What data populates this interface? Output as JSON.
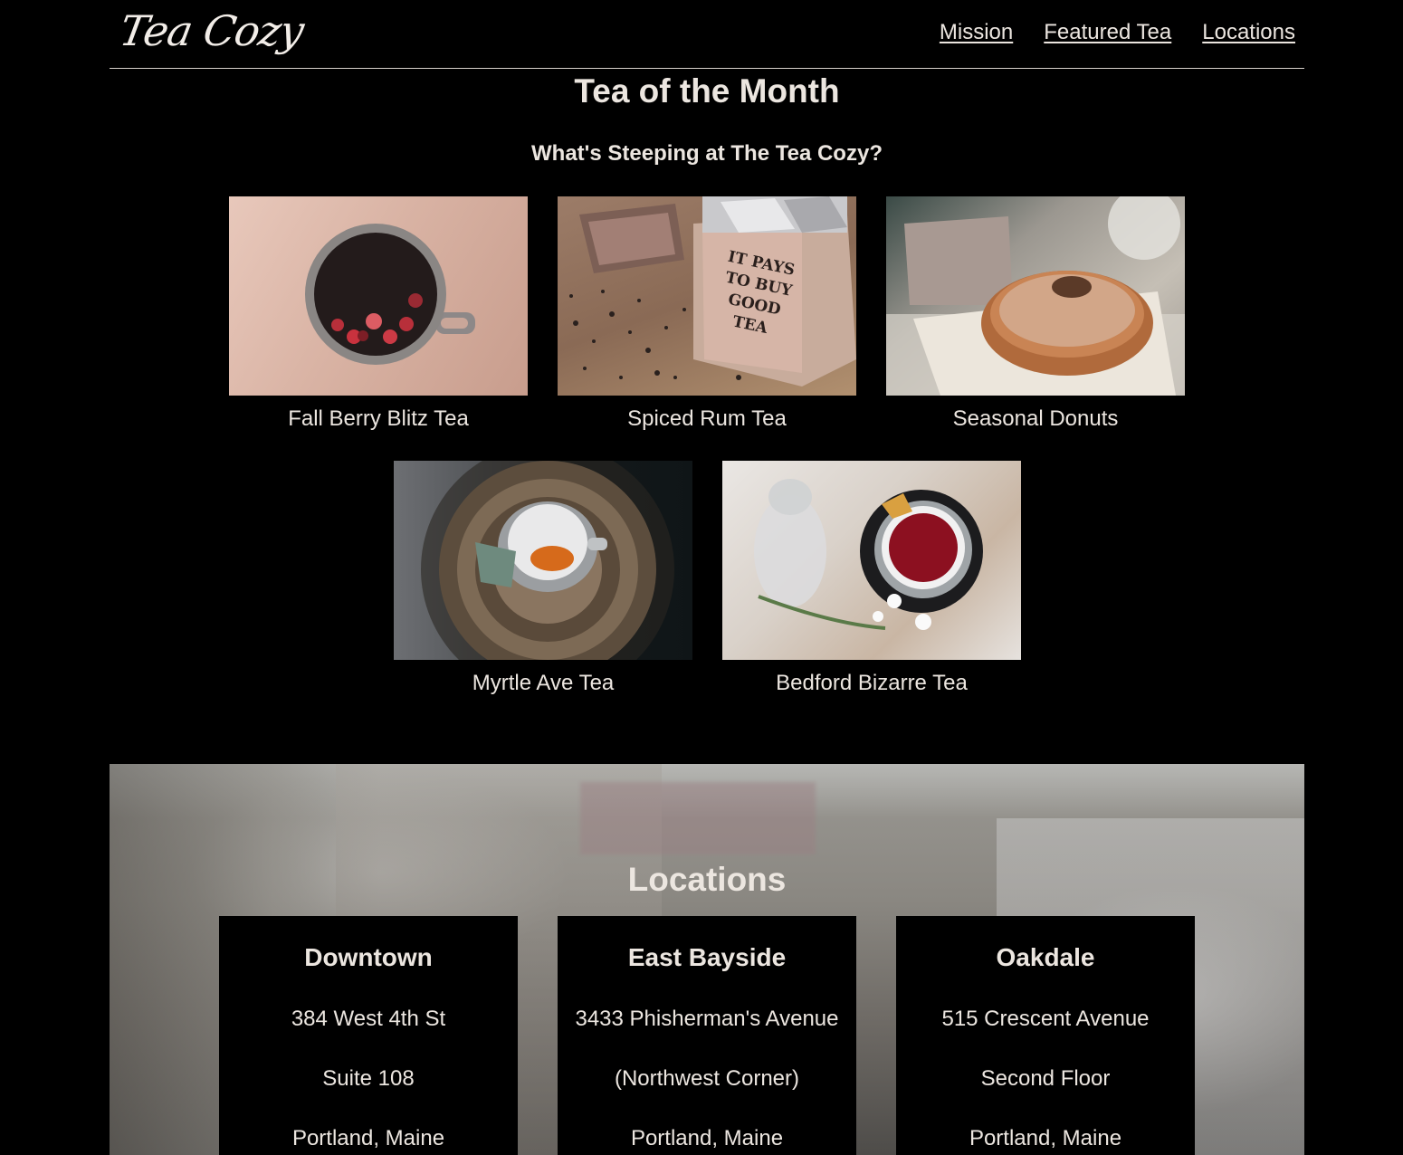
{
  "header": {
    "logo": "Tea Cozy",
    "nav": [
      "Mission",
      "Featured Tea",
      "Locations"
    ]
  },
  "featured": {
    "title": "Tea of the Month",
    "subtitle": "What's Steeping at The Tea Cozy?",
    "items": [
      {
        "name": "Fall Berry Blitz Tea",
        "image": "berry-tea-mug-photo"
      },
      {
        "name": "Spiced Rum Tea",
        "image": "tea-box-photo"
      },
      {
        "name": "Seasonal Donuts",
        "image": "donut-photo"
      },
      {
        "name": "Myrtle Ave Tea",
        "image": "tea-cup-on-tray-photo"
      },
      {
        "name": "Bedford Bizarre Tea",
        "image": "red-tea-cup-photo"
      }
    ]
  },
  "locations": {
    "title": "Locations",
    "cards": [
      {
        "name": "Downtown",
        "lines": [
          "384 West 4th St",
          "Suite 108",
          "Portland, Maine"
        ]
      },
      {
        "name": "East Bayside",
        "lines": [
          "3433 Phisherman's Avenue",
          "(Northwest Corner)",
          "Portland, Maine"
        ]
      },
      {
        "name": "Oakdale",
        "lines": [
          "515 Crescent Avenue",
          "Second Floor",
          "Portland, Maine"
        ]
      }
    ]
  }
}
